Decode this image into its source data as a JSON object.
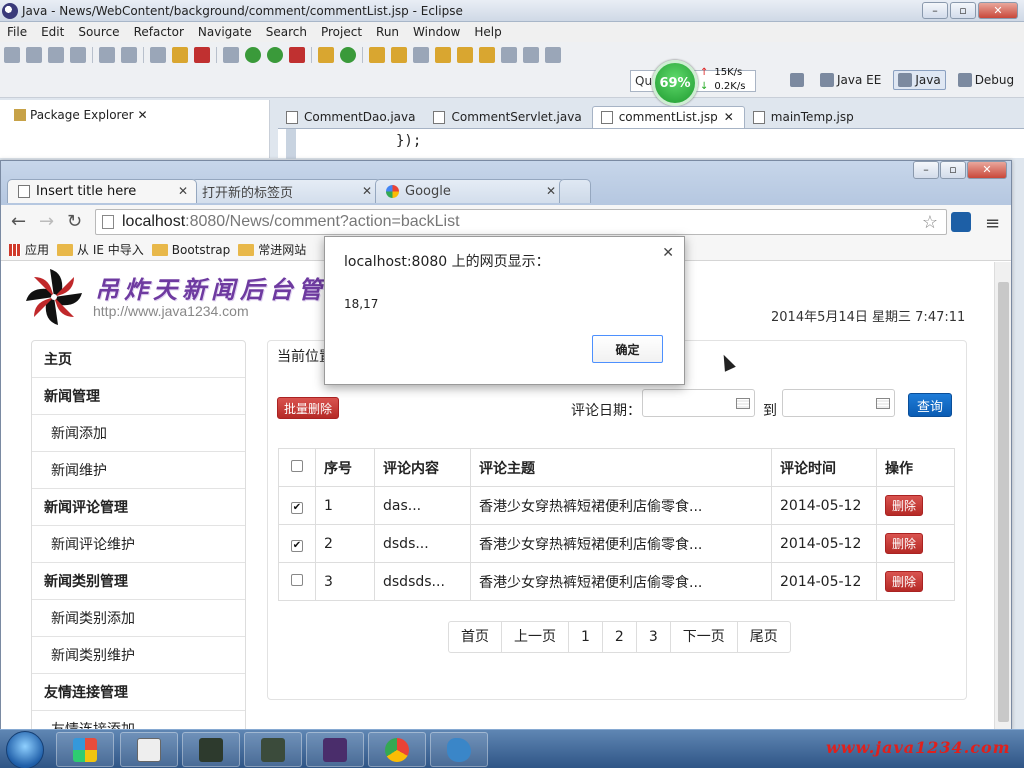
{
  "eclipse": {
    "title": "Java - News/WebContent/background/comment/commentList.jsp - Eclipse",
    "menu": [
      "File",
      "Edit",
      "Source",
      "Refactor",
      "Navigate",
      "Search",
      "Project",
      "Run",
      "Window",
      "Help"
    ],
    "quick_access_placeholder": "Qui",
    "perf_percent": "69%",
    "net_up": "15K/s",
    "net_down": "0.2K/s",
    "perspectives": [
      "Java EE",
      "Java",
      "Debug"
    ],
    "active_perspective": "Java",
    "package_explorer_title": "Package Explorer",
    "editor_tabs": [
      "CommentDao.java",
      "CommentServlet.java",
      "commentList.jsp",
      "mainTemp.jsp"
    ],
    "active_editor_tab": "commentList.jsp",
    "code_line": "});"
  },
  "browser": {
    "tabs": [
      {
        "label": "Insert title here",
        "active": true
      },
      {
        "label": "打开新的标签页",
        "active": false
      },
      {
        "label": "Google",
        "active": false
      }
    ],
    "url_host": "localhost",
    "url_path": ":8080/News/comment?action=backList",
    "bookmarks": [
      "应用",
      "从 IE 中导入",
      "Bootstrap",
      "常进网站"
    ]
  },
  "page": {
    "logo_text": "吊炸天新闻后台管",
    "logo_url": "http://www.java1234.com",
    "datetime": "2014年5月14日 星期三 7:47:11",
    "breadcrumb": "当前位置",
    "nav": [
      {
        "label": "主页",
        "type": "head"
      },
      {
        "label": "新闻管理",
        "type": "head"
      },
      {
        "label": "新闻添加",
        "type": "sub"
      },
      {
        "label": "新闻维护",
        "type": "sub"
      },
      {
        "label": "新闻评论管理",
        "type": "head"
      },
      {
        "label": "新闻评论维护",
        "type": "sub"
      },
      {
        "label": "新闻类别管理",
        "type": "head"
      },
      {
        "label": "新闻类别添加",
        "type": "sub"
      },
      {
        "label": "新闻类别维护",
        "type": "sub"
      },
      {
        "label": "友情连接管理",
        "type": "head"
      },
      {
        "label": "友情连接添加",
        "type": "sub"
      }
    ],
    "batch_delete_label": "批量删除",
    "date_filter_label": "评论日期：",
    "date_to_label": "到",
    "query_label": "查询",
    "table_headers": [
      "序号",
      "评论内容",
      "评论主题",
      "评论时间",
      "操作"
    ],
    "rows": [
      {
        "checked": true,
        "no": "1",
        "content": "das...",
        "topic": "香港少女穿热裤短裙便利店偷零食...",
        "time": "2014-05-12",
        "action": "删除"
      },
      {
        "checked": true,
        "no": "2",
        "content": "dsds...",
        "topic": "香港少女穿热裤短裙便利店偷零食...",
        "time": "2014-05-12",
        "action": "删除"
      },
      {
        "checked": false,
        "no": "3",
        "content": "dsdsds...",
        "topic": "香港少女穿热裤短裙便利店偷零食...",
        "time": "2014-05-12",
        "action": "删除"
      }
    ],
    "pager": [
      "首页",
      "上一页",
      "1",
      "2",
      "3",
      "下一页",
      "尾页"
    ]
  },
  "alert": {
    "title": "localhost:8080 上的网页显示：",
    "message": "18,17",
    "ok_label": "确定"
  },
  "taskbar": {
    "watermark": "www.java1234.com"
  }
}
